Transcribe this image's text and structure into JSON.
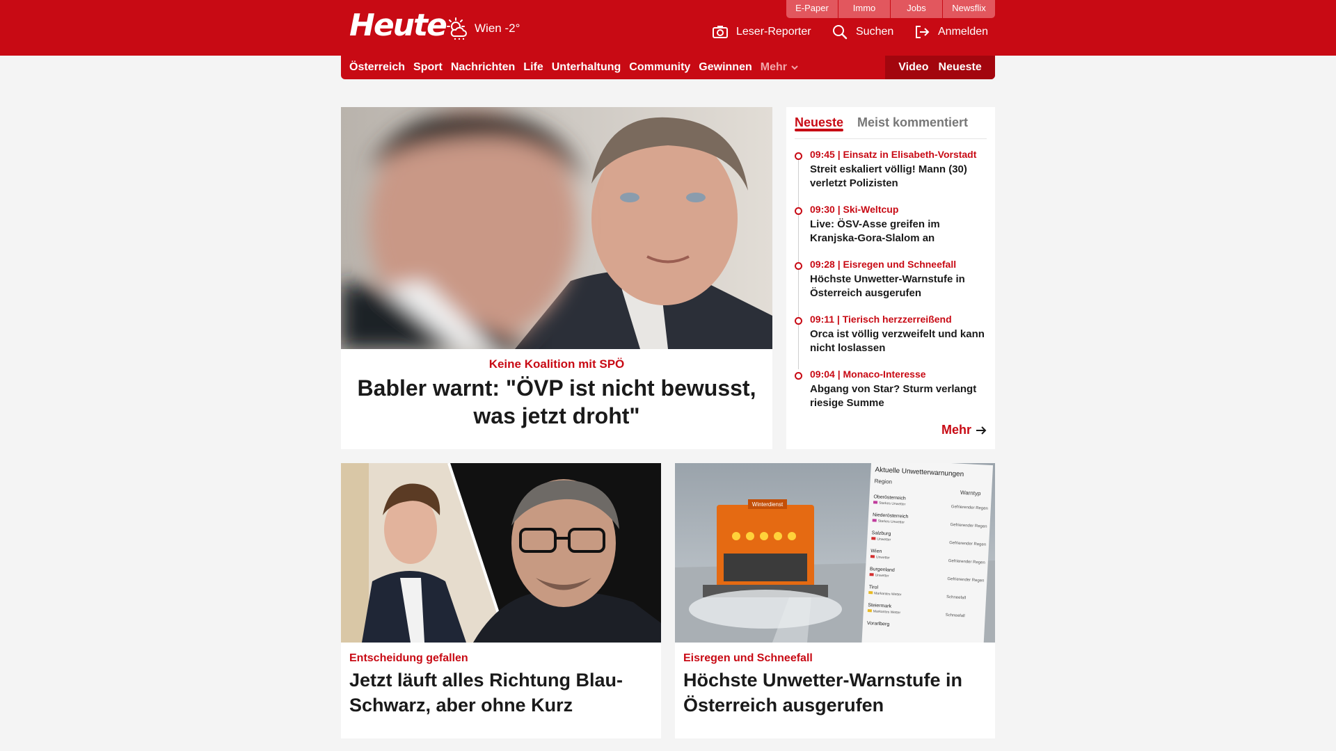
{
  "header": {
    "logo": "Heute",
    "weather": "Wien -2°",
    "top_tabs": [
      "E-Paper",
      "Immo",
      "Jobs",
      "Newsflix"
    ],
    "actions": {
      "reporter": "Leser-Reporter",
      "search": "Suchen",
      "login": "Anmelden"
    }
  },
  "nav": {
    "items": [
      "Österreich",
      "Sport",
      "Nachrichten",
      "Life",
      "Unterhaltung",
      "Community",
      "Gewinnen"
    ],
    "more": "Mehr",
    "right": [
      "Video",
      "Neueste"
    ]
  },
  "hero": {
    "kicker": "Keine Koalition mit SPÖ",
    "title": "Babler warnt: \"ÖVP ist nicht bewusst, was jetzt droht\""
  },
  "sidebar": {
    "tabs": [
      "Neueste",
      "Meist kommentiert"
    ],
    "items": [
      {
        "meta": "09:45 | Einsatz in Elisabeth-Vorstadt",
        "title": "Streit eskaliert völlig! Mann (30) verletzt Polizisten"
      },
      {
        "meta": "09:30 | Ski-Weltcup",
        "title": "Live: ÖSV-Asse greifen im Kranjska-Gora-Slalom an"
      },
      {
        "meta": "09:28 | Eisregen und Schneefall",
        "title": "Höchste Unwetter-Warnstufe in Österreich ausgerufen"
      },
      {
        "meta": "09:11 | Tierisch herzzerreißend",
        "title": "Orca ist völlig verzweifelt und kann nicht loslassen"
      },
      {
        "meta": "09:04 | Monaco-Interesse",
        "title": "Abgang von Star? Sturm verlangt riesige Summe"
      }
    ],
    "more": "Mehr"
  },
  "cards": [
    {
      "kicker": "Entscheidung gefallen",
      "title": "Jetzt läuft alles Richtung Blau-Schwarz, aber ohne Kurz"
    },
    {
      "kicker": "Eisregen und Schneefall",
      "title": "Höchste Unwetter-Warnstufe in Österreich ausgerufen"
    }
  ],
  "warning_table": {
    "title": "Aktuelle Unwetterwarnungen",
    "headers": [
      "Region",
      "Warntyp"
    ],
    "rows": [
      {
        "region": "Oberösterreich",
        "level": "Starkes Unwetter",
        "type": "Gefrierender Regen"
      },
      {
        "region": "Niederösterreich",
        "level": "Starkes Unwetter",
        "type": "Gefrierender Regen"
      },
      {
        "region": "Salzburg",
        "level": "Unwetter",
        "type": "Gefrierender Regen"
      },
      {
        "region": "Wien",
        "level": "Unwetter",
        "type": "Gefrierender Regen"
      },
      {
        "region": "Burgenland",
        "level": "Unwetter",
        "type": "Gefrierender Regen"
      },
      {
        "region": "Tirol",
        "level": "Markantes Wetter",
        "type": "Schneefall"
      },
      {
        "region": "Steiermark",
        "level": "Markantes Wetter",
        "type": "Schneefall"
      },
      {
        "region": "Vorarlberg",
        "level": "",
        "type": ""
      }
    ]
  },
  "vehicle_label": "Winterdienst",
  "colors": {
    "brand_red": "#c80a14",
    "dark_red": "#a3060e",
    "background": "#f4f4f4"
  }
}
